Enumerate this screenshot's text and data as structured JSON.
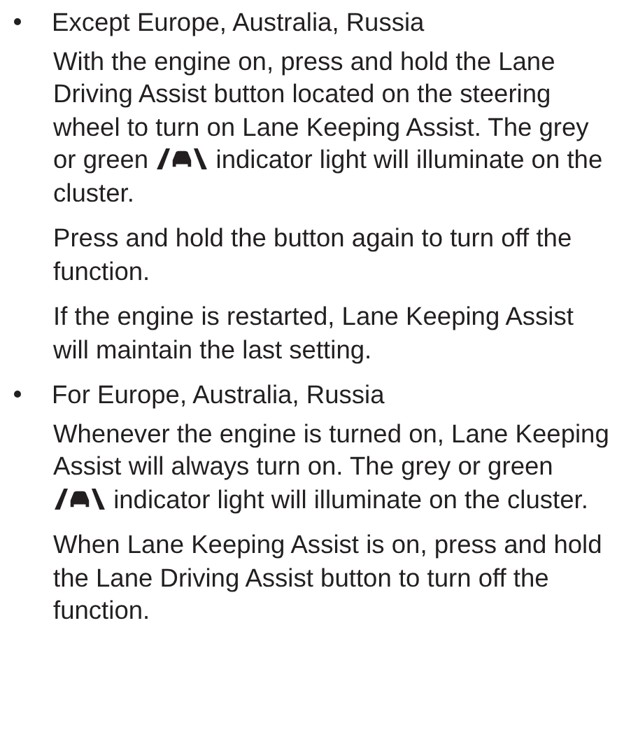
{
  "sections": [
    {
      "heading": "Except Europe, Australia, Russia",
      "paragraphs": [
        {
          "parts": [
            {
              "kind": "text",
              "text": "With the engine on, press and hold the Lane Driving Assist button located on the steering wheel to turn on Lane Keeping Assist. The grey or green "
            },
            {
              "kind": "lane-icon"
            },
            {
              "kind": "text",
              "text": " indicator light will illuminate on the cluster."
            }
          ]
        },
        {
          "parts": [
            {
              "kind": "text",
              "text": "Press and hold the button again to turn off the function."
            }
          ]
        },
        {
          "parts": [
            {
              "kind": "text",
              "text": "If the engine is restarted, Lane Keeping Assist will maintain the last setting."
            }
          ]
        }
      ]
    },
    {
      "heading": "For Europe, Australia, Russia",
      "paragraphs": [
        {
          "parts": [
            {
              "kind": "text",
              "text": "Whenever the engine is turned on, Lane Keeping Assist will always turn on. The grey or green "
            },
            {
              "kind": "lane-icon"
            },
            {
              "kind": "text",
              "text": " indicator light will illuminate on the cluster."
            }
          ]
        },
        {
          "parts": [
            {
              "kind": "text",
              "text": "When Lane Keeping Assist is on, press and hold the Lane Driving Assist button to turn off the function."
            }
          ]
        }
      ]
    }
  ]
}
